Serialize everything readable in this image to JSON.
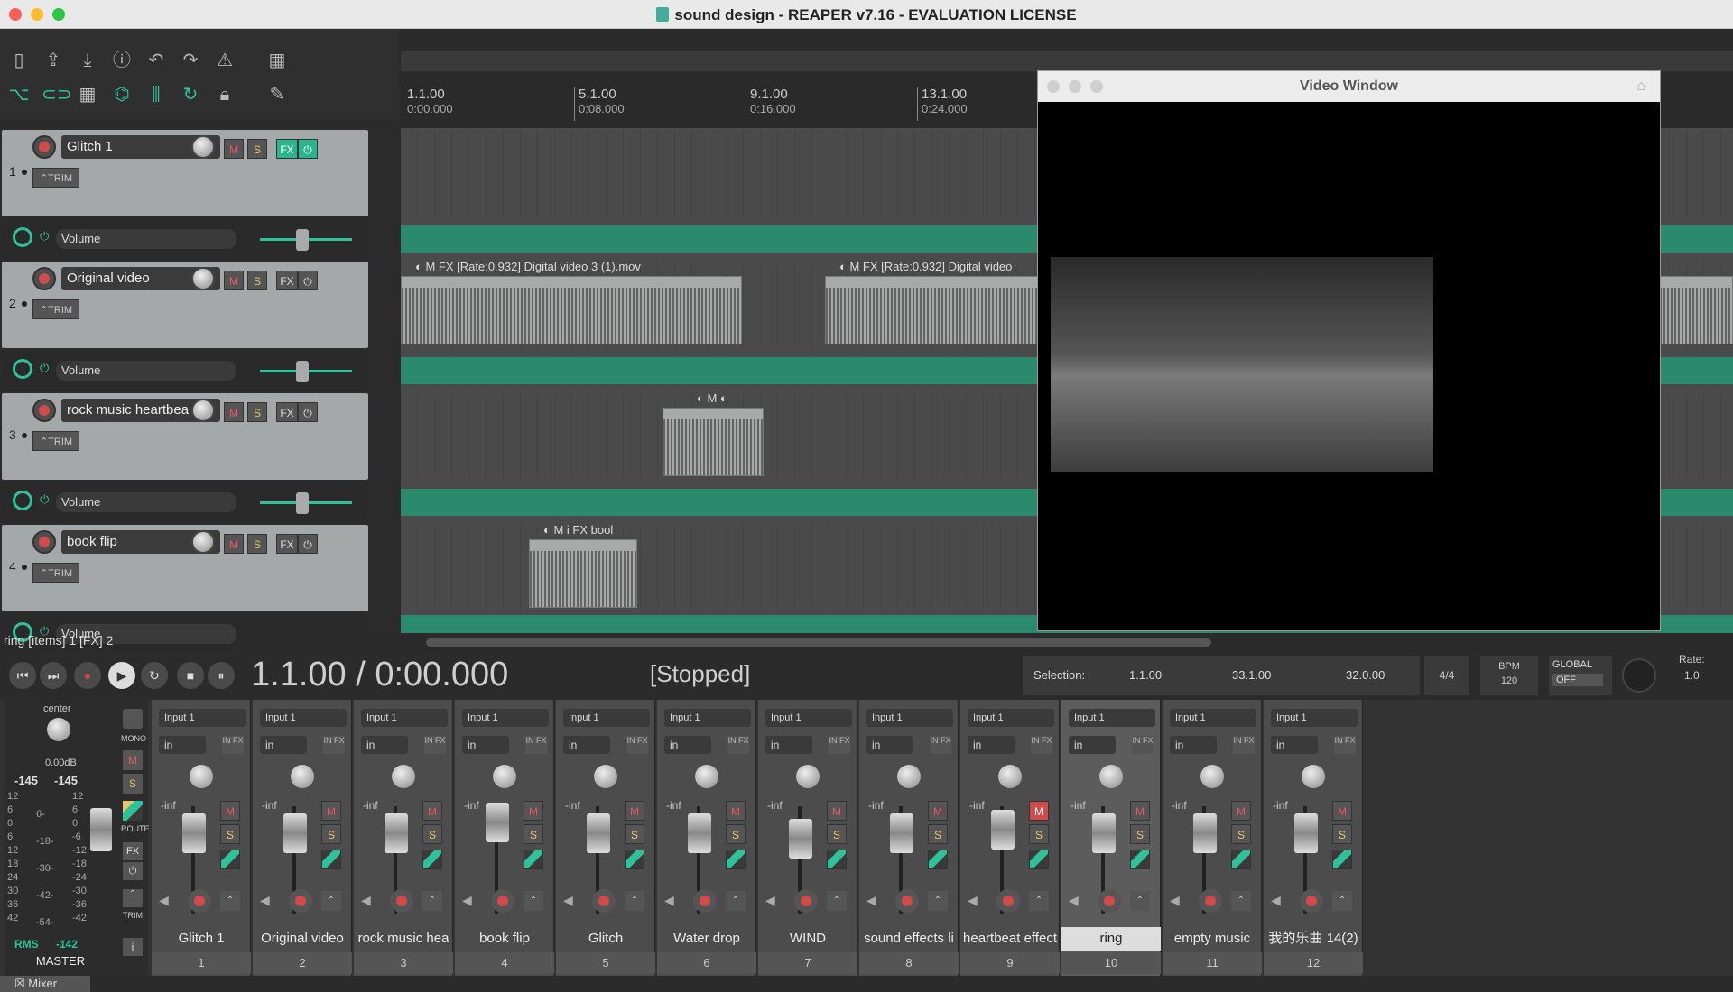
{
  "window": {
    "title": "sound design - REAPER v7.16 - EVALUATION LICENSE"
  },
  "ruler": {
    "marks": [
      {
        "bar": "1.1.00",
        "time": "0:00.000"
      },
      {
        "bar": "5.1.00",
        "time": "0:08.000"
      },
      {
        "bar": "9.1.00",
        "time": "0:16.000"
      },
      {
        "bar": "13.1.00",
        "time": "0:24.000"
      }
    ]
  },
  "tracks": [
    {
      "num": "1",
      "name": "Glitch 1",
      "fx_active": true,
      "env_label": "Volume"
    },
    {
      "num": "2",
      "name": "Original video",
      "fx_active": false,
      "env_label": "Volume"
    },
    {
      "num": "3",
      "name": "rock music heartbea",
      "fx_active": false,
      "env_label": "Volume"
    },
    {
      "num": "4",
      "name": "book flip",
      "fx_active": false,
      "env_label": "Volume"
    }
  ],
  "labels": {
    "mute": "M",
    "solo": "S",
    "fx": "FX",
    "trim": "TRIM",
    "power": "⏻"
  },
  "items": {
    "item1_label": "[Rate:0.932] Digital video 3 (1).mov",
    "item2_label": "[Rate:0.932] Digital video",
    "item4_label": "bool"
  },
  "video": {
    "title": "Video Window"
  },
  "status": {
    "text": "ring [items] 1 [FX] 2"
  },
  "transport": {
    "time": "1.1.00 / 0:00.000",
    "state": "[Stopped]",
    "selection_label": "Selection:",
    "sel_start": "1.1.00",
    "sel_end": "33.1.00",
    "sel_len": "32.0.00",
    "time_sig": "4/4",
    "bpm_label": "BPM",
    "bpm": "120",
    "global_label": "GLOBAL",
    "global_value": "OFF",
    "rate_label": "Rate:",
    "rate": "1.0"
  },
  "master": {
    "pan_label": "center",
    "db": "0.00dB",
    "peak_l": "-145",
    "peak_r": "-145",
    "rms_label": "RMS",
    "rms": "-142",
    "name": "MASTER",
    "mono": "MONO",
    "route": "ROUTE",
    "trim": "TRIM",
    "info": "i",
    "scale_left": [
      "12",
      "6",
      "0",
      "6",
      "12",
      "18",
      "24",
      "30",
      "36",
      "42"
    ],
    "scale_mid": [
      "6-",
      "-18-",
      "-30-",
      "-42-",
      "-54-"
    ],
    "scale_right": [
      "12",
      "6",
      "0",
      "-6",
      "-12",
      "-18",
      "-24",
      "-30",
      "-36",
      "-42"
    ]
  },
  "mixer": {
    "input_label": "Input 1",
    "in_label": "in",
    "infx_label": "IN FX",
    "inf_label": "-inf",
    "strips": [
      {
        "name": "Glitch 1",
        "num": "1"
      },
      {
        "name": "Original video",
        "num": "2"
      },
      {
        "name": "rock music hea",
        "num": "3"
      },
      {
        "name": "book flip",
        "num": "4"
      },
      {
        "name": "Glitch",
        "num": "5"
      },
      {
        "name": "Water drop",
        "num": "6"
      },
      {
        "name": "WIND",
        "num": "7"
      },
      {
        "name": "sound effects li",
        "num": "8"
      },
      {
        "name": "heartbeat effect",
        "num": "9"
      },
      {
        "name": "ring",
        "num": "10"
      },
      {
        "name": "empty music",
        "num": "11"
      },
      {
        "name": "我的乐曲 14(2)",
        "num": "12"
      }
    ],
    "tab_label": "Mixer"
  }
}
